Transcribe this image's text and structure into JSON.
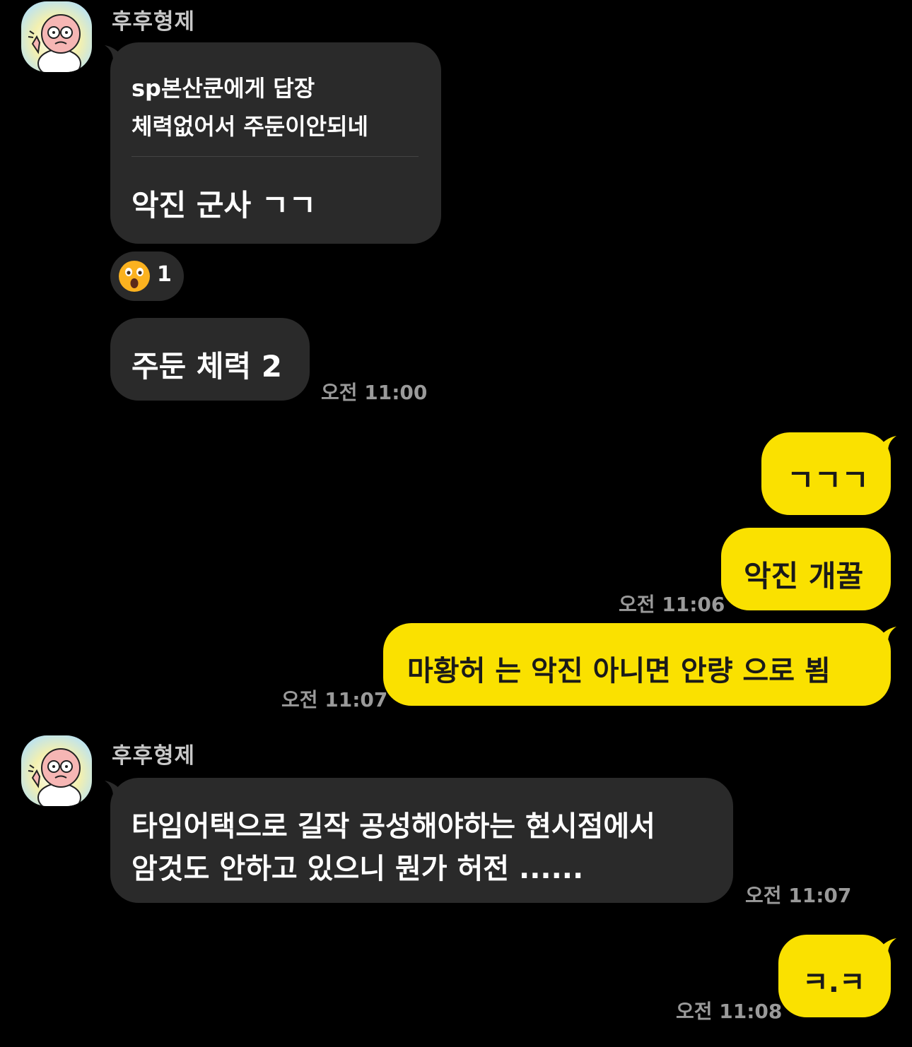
{
  "messages": {
    "group1": {
      "sender": "후후형제",
      "reply": {
        "header": "sp본산쿤에게 답장",
        "quoted": "체력없어서 주둔이안되네",
        "text": "악진 군사 ㄱㄱ"
      },
      "reaction": {
        "emoji": "astonished-face-emoji",
        "count": "1"
      },
      "msg2": "주둔 체력 2",
      "time": "오전 11:00"
    },
    "mine1": {
      "msg1": "ㄱㄱㄱ",
      "msg2": "악진 개꿀",
      "time": "오전 11:06"
    },
    "mine2": {
      "msg1": "마황허 는 악진 아니면 안량 으로 뵘",
      "time": "오전 11:07"
    },
    "group2": {
      "sender": "후후형제",
      "line1": "타임어택으로 길작 공성해야하는 현시점에서",
      "line2": "암것도 안하고 있으니 뭔가 허전 ......",
      "time": "오전 11:07"
    },
    "mine3": {
      "msg1": "ㅋ.ㅋ",
      "time": "오전 11:08"
    }
  },
  "colors": {
    "background": "#000000",
    "incoming_bubble": "#2a2a2a",
    "outgoing_bubble": "#fae100",
    "timestamp": "#9a9a9a"
  }
}
